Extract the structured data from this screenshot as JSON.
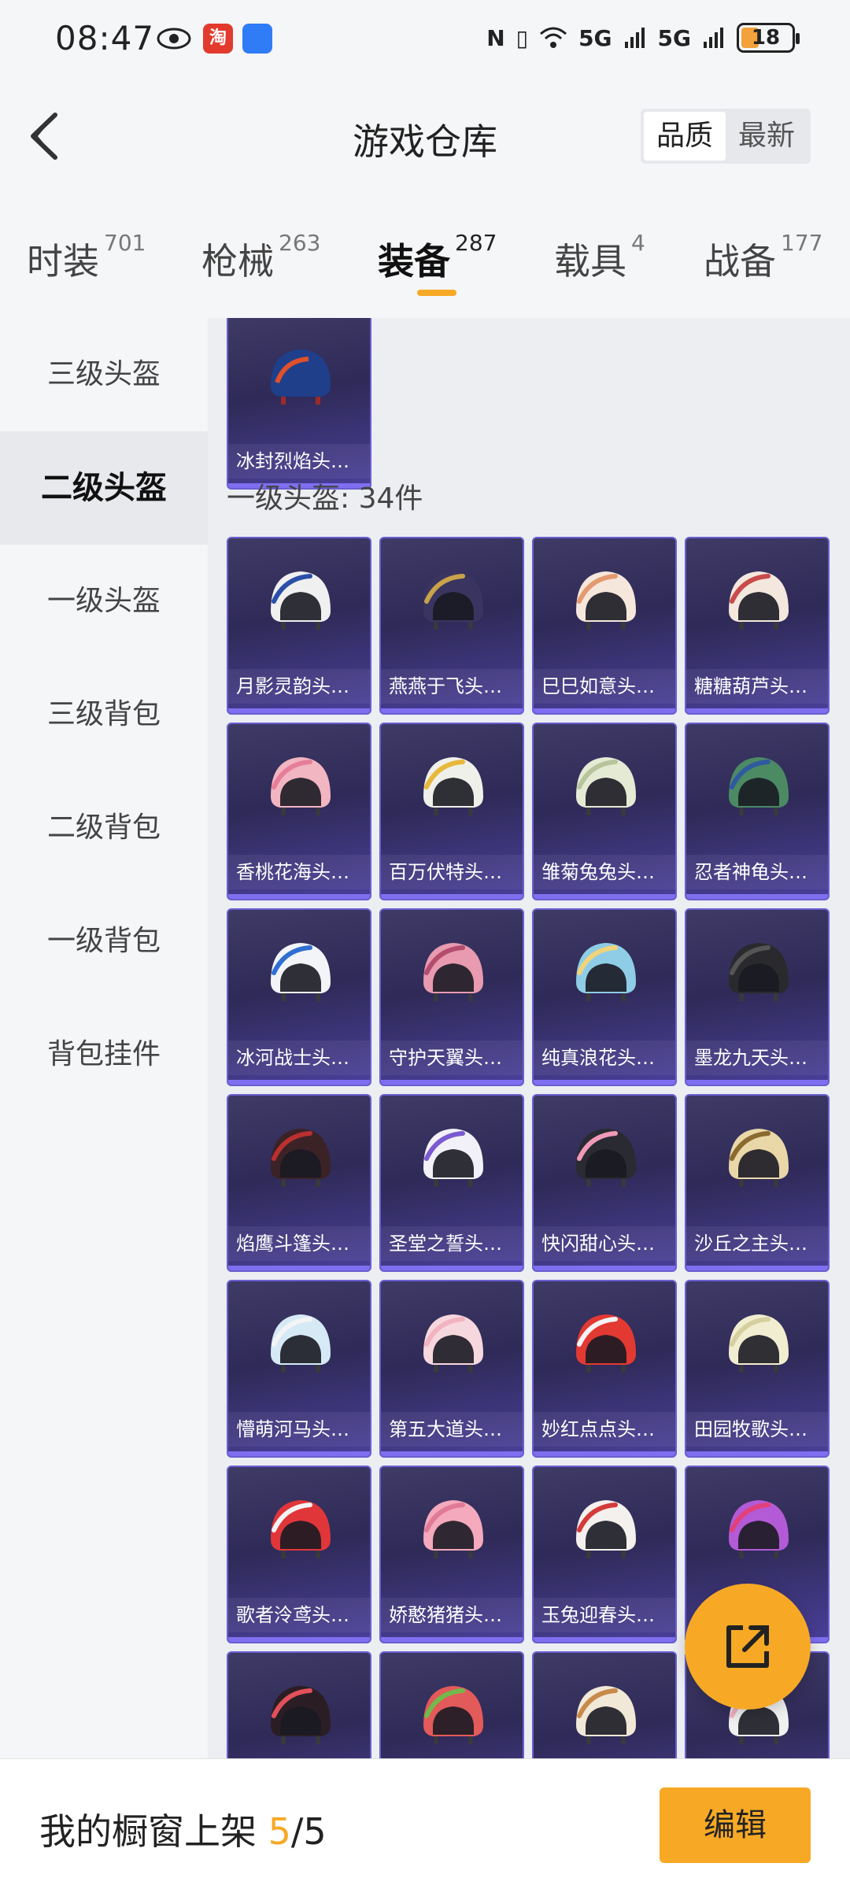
{
  "status_bar": {
    "time": "08:47",
    "battery": "18",
    "network_1": "5G",
    "network_2": "5G",
    "app_badge": "淘"
  },
  "header": {
    "title": "游戏仓库",
    "sort_options": [
      "品质",
      "最新"
    ]
  },
  "tabs": [
    {
      "label": "时装",
      "count": "701"
    },
    {
      "label": "枪械",
      "count": "263"
    },
    {
      "label": "装备",
      "count": "287"
    },
    {
      "label": "载具",
      "count": "4"
    },
    {
      "label": "战备",
      "count": "177"
    }
  ],
  "sidebar": [
    {
      "label": "三级头盔"
    },
    {
      "label": "二级头盔"
    },
    {
      "label": "一级头盔"
    },
    {
      "label": "三级背包"
    },
    {
      "label": "二级背包"
    },
    {
      "label": "一级背包"
    },
    {
      "label": "背包挂件"
    }
  ],
  "content": {
    "top_card": {
      "name": "冰封烈焰头盔..."
    },
    "section_title": "一级头盔: 34件",
    "items": [
      {
        "name": "月影灵韵头盔...",
        "icon": "helmet-icon",
        "color": "#f0f0f0",
        "accent": "#2a4fa8"
      },
      {
        "name": "燕燕于飞头盔...",
        "icon": "helmet-icon",
        "color": "#3a3560",
        "accent": "#c9a24a"
      },
      {
        "name": "巳巳如意头盔...",
        "icon": "helmet-icon",
        "color": "#f6e7dc",
        "accent": "#e39a6f"
      },
      {
        "name": "糖糖葫芦头盔...",
        "icon": "helmet-icon",
        "color": "#f4e7dd",
        "accent": "#c94a4a"
      },
      {
        "name": "香桃花海头盔...",
        "icon": "helmet-icon",
        "color": "#f2b5c2",
        "accent": "#e77e99"
      },
      {
        "name": "百万伏特头盔...",
        "icon": "helmet-icon",
        "color": "#f0f0ea",
        "accent": "#e7b83a"
      },
      {
        "name": "雏菊兔兔头盔...",
        "icon": "helmet-icon",
        "color": "#e4ead4",
        "accent": "#b7c49c"
      },
      {
        "name": "忍者神龟头盔...",
        "icon": "helmet-icon",
        "color": "#4c8a64",
        "accent": "#2f5aa0"
      },
      {
        "name": "冰河战士头盔...",
        "icon": "helmet-icon",
        "color": "#f2f4f8",
        "accent": "#2f6ed3"
      },
      {
        "name": "守护天翼头盔...",
        "icon": "helmet-icon",
        "color": "#e89ab0",
        "accent": "#b34d6e"
      },
      {
        "name": "纯真浪花头盔...",
        "icon": "helmet-icon",
        "color": "#8fcde6",
        "accent": "#f0d37a"
      },
      {
        "name": "墨龙九天头盔...",
        "icon": "helmet-icon",
        "color": "#2a2a2e",
        "accent": "#555"
      },
      {
        "name": "焰鹰斗篷头盔...",
        "icon": "helmet-icon",
        "color": "#3a2226",
        "accent": "#b93030"
      },
      {
        "name": "圣堂之誓头盔...",
        "icon": "helmet-icon",
        "color": "#f3f1f8",
        "accent": "#7a5ad0"
      },
      {
        "name": "快闪甜心头盔...",
        "icon": "helmet-icon",
        "color": "#2a2a32",
        "accent": "#f09ab8"
      },
      {
        "name": "沙丘之主头盔...",
        "icon": "helmet-icon",
        "color": "#e9d7a8",
        "accent": "#8a6a2e"
      },
      {
        "name": "懵萌河马头盔...",
        "icon": "helmet-icon",
        "color": "#d6eaf6",
        "accent": "#f4f4f4"
      },
      {
        "name": "第五大道头盔...",
        "icon": "helmet-icon",
        "color": "#f7d7de",
        "accent": "#f2b3c0"
      },
      {
        "name": "妙红点点头盔...",
        "icon": "helmet-icon",
        "color": "#e23a32",
        "accent": "#f4f4f4"
      },
      {
        "name": "田园牧歌头盔...",
        "icon": "helmet-icon",
        "color": "#f1edd0",
        "accent": "#d6d0a0"
      },
      {
        "name": "歌者泠鸢头盔...",
        "icon": "helmet-icon",
        "color": "#e0363a",
        "accent": "#f4f4f4"
      },
      {
        "name": "娇憨猪猪头盔...",
        "icon": "helmet-icon",
        "color": "#f4a9bd",
        "accent": "#e07a96"
      },
      {
        "name": "玉兔迎春头盔...",
        "icon": "helmet-icon",
        "color": "#f4f0ee",
        "accent": "#d53a3a"
      },
      {
        "name": "",
        "icon": "helmet-icon",
        "color": "#b35ad6",
        "accent": "#e3407a"
      },
      {
        "name": "",
        "icon": "helmet-icon",
        "color": "#2a1e24",
        "accent": "#e2505a"
      },
      {
        "name": "",
        "icon": "helmet-icon",
        "color": "#e35a5a",
        "accent": "#72b84a"
      },
      {
        "name": "",
        "icon": "helmet-icon",
        "color": "#f1e8d8",
        "accent": "#c88a4a"
      },
      {
        "name": "",
        "icon": "helmet-icon",
        "color": "#f0f0f0",
        "accent": "#f2b3c0"
      }
    ]
  },
  "bottom_bar": {
    "label": "我的橱窗上架 ",
    "current": "5",
    "total": "/5",
    "edit_label": "编辑"
  },
  "colors": {
    "accent": "#f7a926",
    "card_bg": "#3a3566",
    "card_border": "#6a5fd0"
  }
}
